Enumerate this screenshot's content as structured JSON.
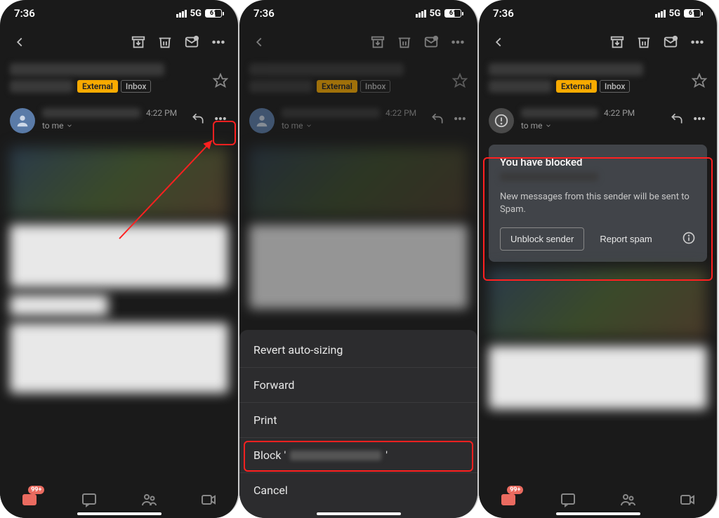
{
  "status": {
    "time": "7:36",
    "network": "5G",
    "battery": "61"
  },
  "toolbar": {},
  "subject": {
    "external_label": "External",
    "inbox_label": "Inbox"
  },
  "sender": {
    "time": "4:22 PM",
    "to_line": "to me"
  },
  "nav": {
    "badge": "99+"
  },
  "sheet": {
    "revert": "Revert auto-sizing",
    "forward": "Forward",
    "print": "Print",
    "block_prefix": "Block '",
    "block_suffix": "'",
    "cancel": "Cancel"
  },
  "blocked": {
    "title": "You have blocked",
    "desc": "New messages from this sender will be sent to Spam.",
    "unblock": "Unblock sender",
    "report": "Report spam"
  }
}
